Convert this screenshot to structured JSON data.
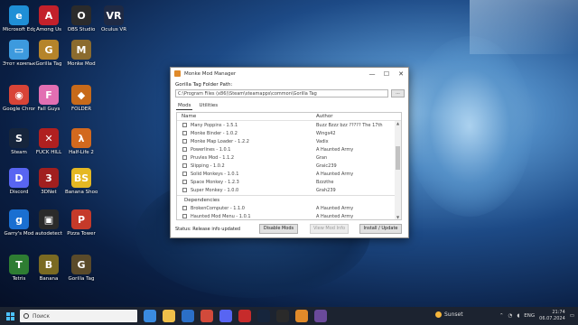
{
  "desktop": {
    "icons": [
      {
        "label": "Microsoft Edge",
        "color": "#1f8fd6",
        "glyph": "e"
      },
      {
        "label": "Among Us",
        "color": "#c3212b",
        "glyph": "A"
      },
      {
        "label": "OBS Studio",
        "color": "#2b2b2b",
        "glyph": "O"
      },
      {
        "label": "Oculus VR",
        "color": "#1f2a44",
        "glyph": "VR"
      },
      {
        "label": "Этот компьютер",
        "color": "#3d9ade",
        "glyph": "▭"
      },
      {
        "label": "Gorilla Tag",
        "color": "#b5842a",
        "glyph": "G"
      },
      {
        "label": "Monke Mod",
        "color": "#8b6b2e",
        "glyph": "M"
      },
      {
        "label": "Google Chrome",
        "color": "#d84437",
        "glyph": "◉"
      },
      {
        "label": "Fall Guys",
        "color": "#e26fb2",
        "glyph": "F"
      },
      {
        "label": "FOLDER",
        "color": "#c76a1a",
        "glyph": "◆"
      },
      {
        "label": "Steam",
        "color": "#16253c",
        "glyph": "S"
      },
      {
        "label": "FUCK HILL",
        "color": "#b02020",
        "glyph": "✕"
      },
      {
        "label": "Half-Life 2",
        "color": "#d2691e",
        "glyph": "λ"
      },
      {
        "label": "Discord",
        "color": "#5865f2",
        "glyph": "D"
      },
      {
        "label": "3DNet",
        "color": "#a11f1f",
        "glyph": "3"
      },
      {
        "label": "Banana Shooter",
        "color": "#e5b823",
        "glyph": "BS"
      },
      {
        "label": "Garry's Mod",
        "color": "#1a6fd1",
        "glyph": "g"
      },
      {
        "label": "autodetect",
        "color": "#2a2a2a",
        "glyph": "▣"
      },
      {
        "label": "Pizza Tower",
        "color": "#c53a2a",
        "glyph": "P"
      },
      {
        "label": "Tetris",
        "color": "#2e7d32",
        "glyph": "T"
      },
      {
        "label": "Banana",
        "color": "#7a6a22",
        "glyph": "B"
      },
      {
        "label": "Gorilla Tag",
        "color": "#5a4a2a",
        "glyph": "G"
      }
    ]
  },
  "window": {
    "title": "Monke Mod Manager",
    "minimize": "—",
    "maximize": "☐",
    "close": "✕",
    "path_label": "Gorilla Tag Folder Path:",
    "path_value": "C:\\Program Files (x86)\\Steam\\steamapps\\common\\Gorilla Tag",
    "browse_label": "...",
    "tabs": [
      {
        "label": "Mods",
        "active": true
      },
      {
        "label": "Utilities",
        "active": false
      }
    ],
    "columns": {
      "name": "Name",
      "author": "Author"
    },
    "mods": [
      {
        "name": "Many Poppins - 1.5.1",
        "author": "Buzz Bzzz bzz ????? The 17th"
      },
      {
        "name": "Monke Binder - 1.0.2",
        "author": "Wings42"
      },
      {
        "name": "Monke Map Loader - 1.2.2",
        "author": "Vadix"
      },
      {
        "name": "Powerlines - 1.0.1",
        "author": "A Haunted Army"
      },
      {
        "name": "Pruvles Mod - 1.1.2",
        "author": "Gran"
      },
      {
        "name": "Slipping - 1.0.2",
        "author": "Graic239"
      },
      {
        "name": "Solid Monkeys - 1.0.1",
        "author": "A Haunted Army"
      },
      {
        "name": "Space Monkey - 1.2.3",
        "author": "Bzzzthe"
      },
      {
        "name": "Super Monkey - 1.0.0",
        "author": "Grah239"
      }
    ],
    "group_label": "Dependencies",
    "extra": [
      {
        "name": "BrokenComputer - 1.1.0",
        "author": "A Haunted Army"
      },
      {
        "name": "Haunted Mod Menu - 1.0.1",
        "author": "A Haunted Army"
      }
    ],
    "status": "Status: Release info updated",
    "buttons": {
      "disable": "Disable Mods",
      "view": "View Mod Info",
      "install": "Install / Update"
    }
  },
  "taskbar": {
    "search_placeholder": "Поиск",
    "weather": "Sunset",
    "lang": "ENG",
    "time": "21:74",
    "date": "06.07.2024"
  }
}
